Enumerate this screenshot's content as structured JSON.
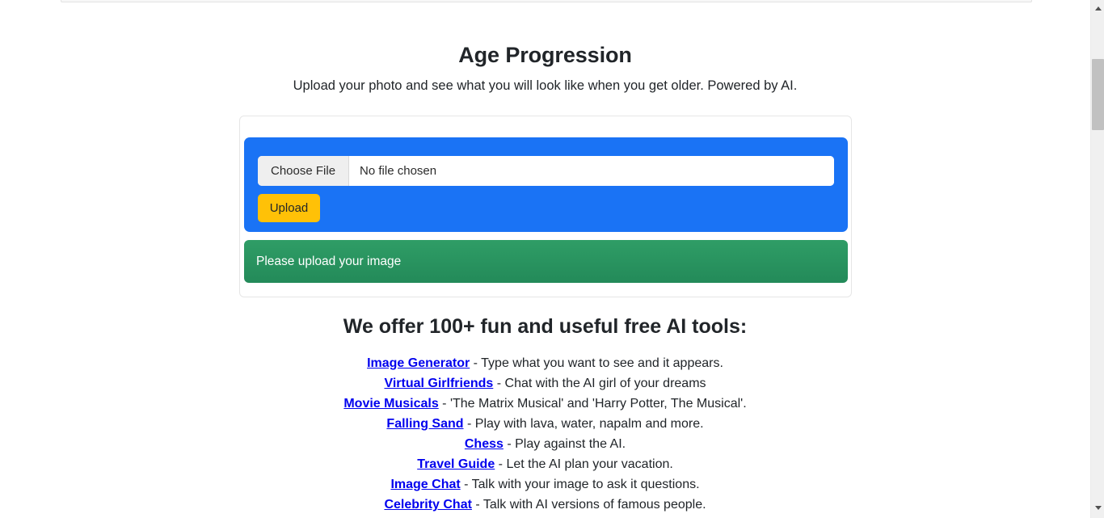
{
  "page": {
    "title": "Age Progression",
    "subtitle": "Upload your photo and see what you will look like when you get older. Powered by AI."
  },
  "upload_form": {
    "choose_file_label": "Choose File",
    "file_name_text": "No file chosen",
    "upload_button_label": "Upload",
    "panel_color": "#1a73f5",
    "upload_button_color": "#ffc107"
  },
  "status": {
    "message": "Please upload your image",
    "color": "#238a59"
  },
  "tools_section": {
    "heading": "We offer 100+ fun and useful free AI tools:",
    "link_color": "#0000ee",
    "items": [
      {
        "link": "Image Generator",
        "desc": " - Type what you want to see and it appears."
      },
      {
        "link": "Virtual Girlfriends",
        "desc": " - Chat with the AI girl of your dreams"
      },
      {
        "link": "Movie Musicals",
        "desc": " - 'The Matrix Musical' and 'Harry Potter, The Musical'."
      },
      {
        "link": "Falling Sand",
        "desc": " - Play with lava, water, napalm and more."
      },
      {
        "link": "Chess",
        "desc": " - Play against the AI."
      },
      {
        "link": "Travel Guide",
        "desc": " - Let the AI plan your vacation."
      },
      {
        "link": "Image Chat",
        "desc": " - Talk with your image to ask it questions."
      },
      {
        "link": "Celebrity Chat",
        "desc": " - Talk with AI versions of famous people."
      }
    ]
  }
}
